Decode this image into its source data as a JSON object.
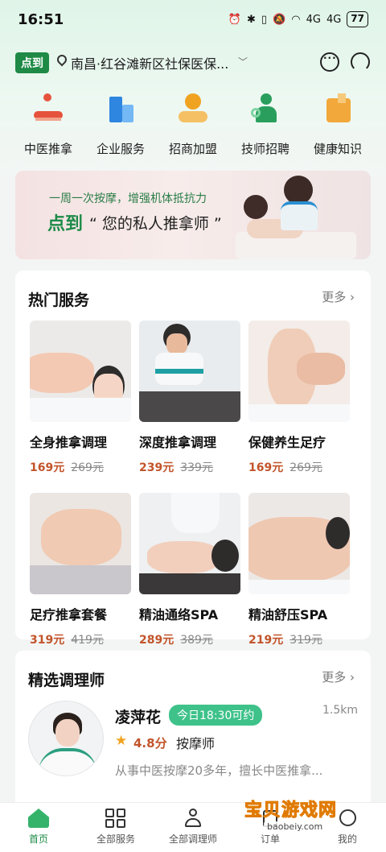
{
  "status_bar": {
    "time": "16:51",
    "icons": [
      "alarm-icon",
      "bluetooth-icon",
      "vibrate-icon",
      "mute-icon",
      "wifi-icon",
      "signal-4g-icon",
      "signal-4g-icon"
    ],
    "signal_1": "4G",
    "signal_2": "4G",
    "battery": "77"
  },
  "header": {
    "brand": "点到",
    "location": "南昌·红谷滩新区社保医保...",
    "icons": [
      "message-icon",
      "customer-service-icon"
    ]
  },
  "quick_nav": [
    {
      "label": "中医推拿",
      "icon": "tcm-massage-icon"
    },
    {
      "label": "企业服务",
      "icon": "enterprise-icon"
    },
    {
      "label": "招商加盟",
      "icon": "franchise-icon"
    },
    {
      "label": "技师招聘",
      "icon": "recruit-icon"
    },
    {
      "label": "健康知识",
      "icon": "health-knowledge-icon"
    }
  ],
  "banner": {
    "subtitle": "一周一次按摩，增强机体抵抗力",
    "brand": "点到",
    "title": "“ 您的私人推拿师 ”"
  },
  "hot_services": {
    "title": "热门服务",
    "more": "更多 ›",
    "items": [
      {
        "name": "全身推拿调理",
        "price": "169元",
        "original_price": "269元"
      },
      {
        "name": "深度推拿调理",
        "price": "239元",
        "original_price": "339元"
      },
      {
        "name": "保健养生足疗",
        "price": "169元",
        "original_price": "269元"
      },
      {
        "name": "足疗推拿套餐",
        "price": "319元",
        "original_price": "419元"
      },
      {
        "name": "精油通络SPA",
        "price": "289元",
        "original_price": "389元"
      },
      {
        "name": "精油舒压SPA",
        "price": "219元",
        "original_price": "319元"
      }
    ]
  },
  "therapists": {
    "title": "精选调理师",
    "more": "更多 ›",
    "items": [
      {
        "name": "凌萍花",
        "availability": "今日18:30可约",
        "distance": "1.5km",
        "rating": "4.8分",
        "role": "按摩师",
        "description": "从事中医按摩20多年，擅长中医推拿..."
      }
    ]
  },
  "tab_bar": [
    {
      "label": "首页",
      "icon": "home-icon",
      "active": true
    },
    {
      "label": "全部服务",
      "icon": "grid-icon",
      "active": false
    },
    {
      "label": "全部调理师",
      "icon": "therapist-icon",
      "active": false
    },
    {
      "label": "订单",
      "icon": "order-icon",
      "active": false
    },
    {
      "label": "我的",
      "icon": "profile-icon",
      "active": false
    }
  ],
  "watermark": {
    "title": "宝贝游戏网",
    "url": "baobeiy.com"
  },
  "colors": {
    "brand_green": "#1f8a46",
    "price_orange": "#c2542a",
    "available_green": "#3ec28a"
  }
}
